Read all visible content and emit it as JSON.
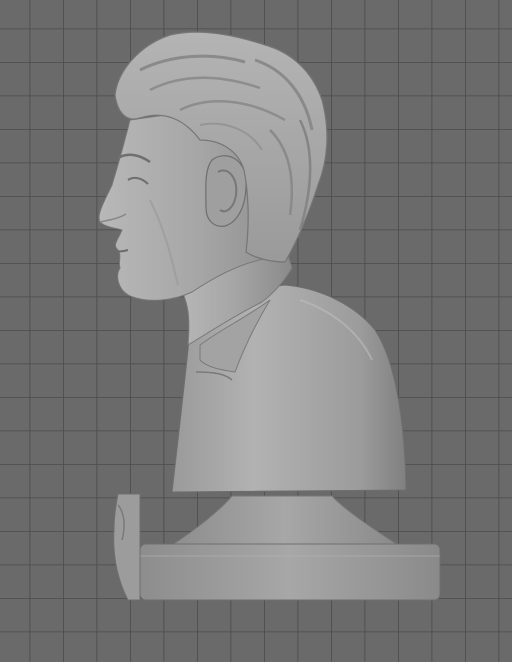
{
  "viewport": {
    "background_color": "#6b6b6b",
    "grid_line_color": "#4a4a4a",
    "model_color": "#a9a9a9"
  },
  "scene": {
    "model_parts": [
      "head-bust",
      "pedestal-base"
    ],
    "icons": [
      "grid-floor-icon",
      "bust-model-icon"
    ]
  }
}
